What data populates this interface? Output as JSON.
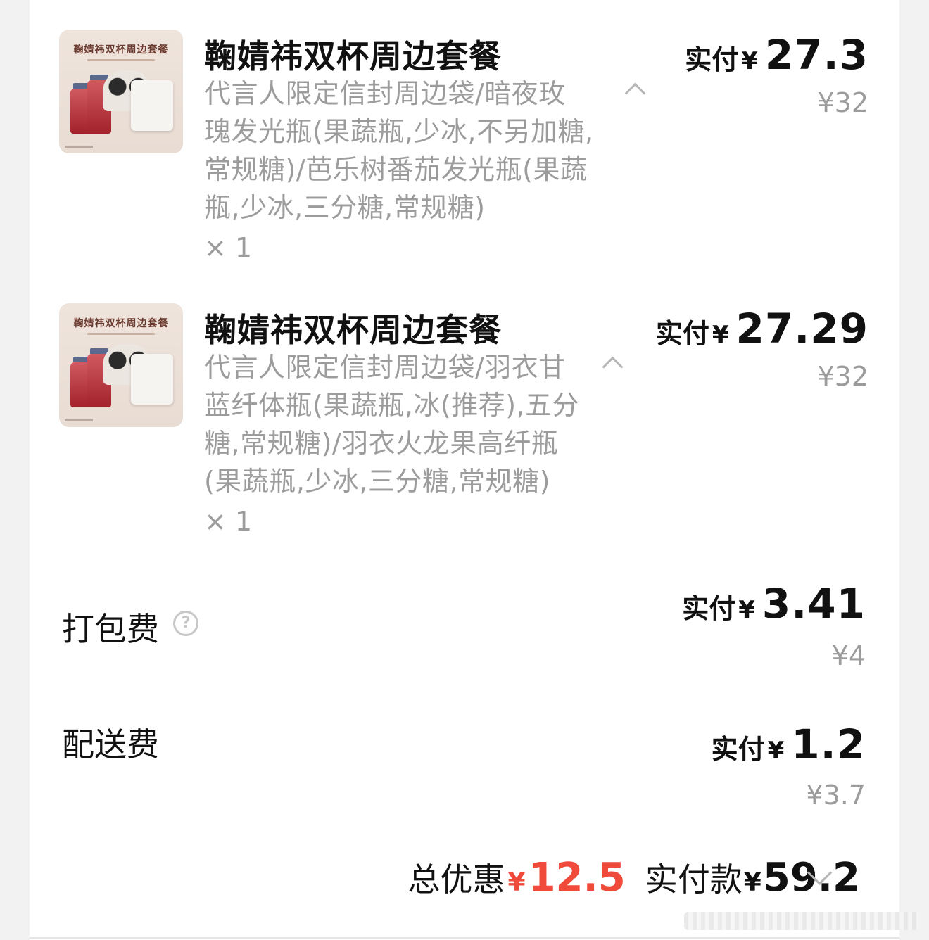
{
  "items": [
    {
      "thumb_caption": "鞠婧祎双杯周边套餐",
      "title": "鞠婧祎双杯周边套餐",
      "desc_lines": [
        "代言人限定信封周边袋/暗夜玫",
        "瑰发光瓶(果蔬瓶,少冰,不另加糖,",
        "常规糖)/芭乐树番茄发光瓶(果蔬",
        "瓶,少冰,三分糖,常规糖)"
      ],
      "qty": "× 1",
      "pay_label": "实付",
      "currency": "¥",
      "pay_amount": "27.3",
      "original_price": "¥32"
    },
    {
      "thumb_caption": "鞠婧祎双杯周边套餐",
      "title": "鞠婧祎双杯周边套餐",
      "desc_lines": [
        "代言人限定信封周边袋/羽衣甘",
        "蓝纤体瓶(果蔬瓶,冰(推荐),五分",
        "糖,常规糖)/羽衣火龙果高纤瓶",
        "(果蔬瓶,少冰,三分糖,常规糖)"
      ],
      "qty": "× 1",
      "pay_label": "实付",
      "currency": "¥",
      "pay_amount": "27.29",
      "original_price": "¥32"
    }
  ],
  "fees": [
    {
      "label": "打包费",
      "help_icon": "?",
      "pay_label": "实付",
      "currency": "¥",
      "pay_amount": "3.41",
      "original_price": "¥4"
    },
    {
      "label": "配送费",
      "pay_label": "实付",
      "currency": "¥",
      "pay_amount": "1.2",
      "original_price": "¥3.7"
    }
  ],
  "summary": {
    "discount_label": "总优惠",
    "discount_currency": "¥",
    "discount_amount": "12.5",
    "total_label": "实付款",
    "total_currency": "¥",
    "total_amount": "59.2"
  },
  "colors": {
    "accent_red": "#ef4a3a",
    "muted_text": "#9c9c9c",
    "background": "#f2f2f2"
  },
  "icons": [
    "chevron-up-icon",
    "help-circle-icon",
    "chevron-down-icon"
  ]
}
